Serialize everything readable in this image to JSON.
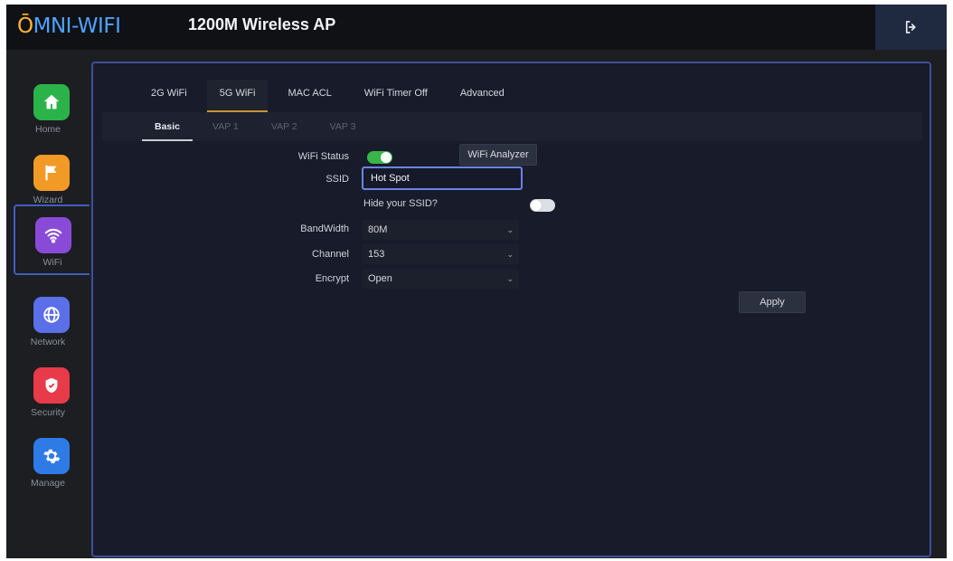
{
  "header": {
    "logo_lead": "Ō",
    "logo_rest": "MNI-WIFI",
    "title": "1200M Wireless AP"
  },
  "sidebar": {
    "items": [
      {
        "label": "Home",
        "color": "#2bb34a",
        "icon": "home-icon"
      },
      {
        "label": "Wizard",
        "color": "#f29a26",
        "icon": "flag-icon"
      },
      {
        "label": "WiFi",
        "color": "#8a4ad8",
        "icon": "wifi-icon",
        "active": true
      },
      {
        "label": "Network",
        "color": "#5a6fe8",
        "icon": "globe-icon"
      },
      {
        "label": "Security",
        "color": "#e83a48",
        "icon": "shield-icon"
      },
      {
        "label": "Manage",
        "color": "#2f7be6",
        "icon": "gear-icon"
      }
    ]
  },
  "tabs": [
    {
      "label": "2G WiFi",
      "active": false
    },
    {
      "label": "5G WiFi",
      "active": true
    },
    {
      "label": "MAC ACL",
      "active": false
    },
    {
      "label": "WiFi Timer Off",
      "active": false
    },
    {
      "label": "Advanced",
      "active": false
    }
  ],
  "subtabs": [
    {
      "label": "Basic",
      "active": true
    },
    {
      "label": "VAP 1",
      "active": false
    },
    {
      "label": "VAP 2",
      "active": false
    },
    {
      "label": "VAP 3",
      "active": false
    }
  ],
  "form": {
    "wifi_status_label": "WiFi Status",
    "wifi_status_on": true,
    "analyzer_button": "WiFi Analyzer",
    "ssid_label": "SSID",
    "ssid_value": "Hot Spot",
    "hide_ssid_label": "Hide your SSID?",
    "hide_ssid_on": false,
    "bandwidth_label": "BandWidth",
    "bandwidth_value": "80M",
    "channel_label": "Channel",
    "channel_value": "153",
    "encrypt_label": "Encrypt",
    "encrypt_value": "Open",
    "apply_button": "Apply"
  },
  "colors": {
    "accent": "#c99430",
    "panel_border": "#3d4f99",
    "logo_blue": "#4ea3ff",
    "logo_orange": "#ffb43a"
  }
}
